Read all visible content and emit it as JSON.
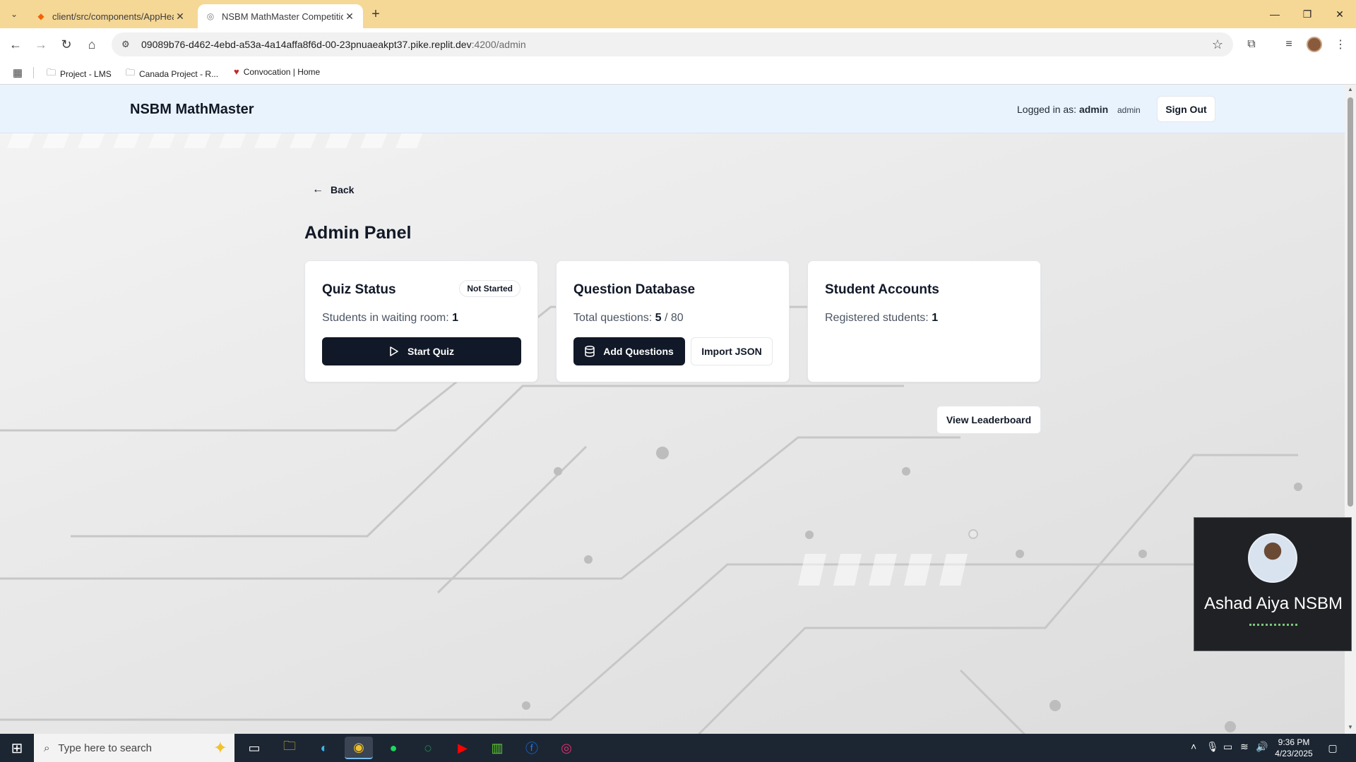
{
  "browser": {
    "tabs": [
      {
        "title": "client/src/components/AppHeader.tsx",
        "active": false
      },
      {
        "title": "NSBM MathMaster Competition",
        "active": true
      }
    ],
    "url_host": "09089b76-d462-4ebd-a53a-4a14affa8f6d-00-23pnuaeakpt37.pike.replit.dev",
    "url_path": ":4200/admin",
    "bookmarks": [
      "Project - LMS",
      "Canada Project - R...",
      "Convocation | Home"
    ]
  },
  "header": {
    "brand": "NSBM MathMaster",
    "logged_in_label": "Logged in as:",
    "logged_in_user": "admin",
    "role": "admin",
    "signout": "Sign Out"
  },
  "main": {
    "back": "Back",
    "title": "Admin Panel",
    "cards": {
      "quiz": {
        "title": "Quiz Status",
        "badge": "Not Started",
        "line_label": "Students in waiting room:",
        "line_value": "1",
        "button": "Start Quiz"
      },
      "questions": {
        "title": "Question Database",
        "line_label": "Total questions:",
        "line_value": "5",
        "line_suffix": "/ 80",
        "add_button": "Add Questions",
        "import_button": "Import JSON"
      },
      "students": {
        "title": "Student Accounts",
        "line_label": "Registered students:",
        "line_value": "1"
      }
    },
    "leaderboard_button": "View Leaderboard"
  },
  "video_overlay": {
    "name": "Ashad Aiya NSBM"
  },
  "taskbar": {
    "search_placeholder": "Type here to search",
    "time": "9:36 PM",
    "date": "4/23/2025"
  },
  "colors": {
    "tab_strip": "#f5d796",
    "header_bg": "#e9f3fd",
    "primary_button": "#111827",
    "taskbar": "#1c2633"
  }
}
